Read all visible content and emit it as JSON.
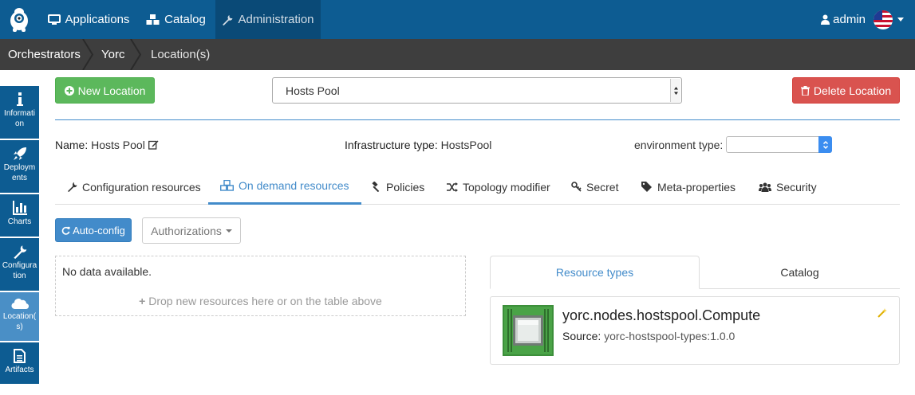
{
  "navbar": {
    "items": [
      {
        "label": "Applications",
        "icon": "monitor-icon"
      },
      {
        "label": "Catalog",
        "icon": "cubes-icon"
      },
      {
        "label": "Administration",
        "icon": "wrench-icon"
      }
    ],
    "user": "admin",
    "flag_icon": "us-flag-icon"
  },
  "breadcrumb": [
    "Orchestrators",
    "Yorc",
    "Location(s)"
  ],
  "sidebar": [
    {
      "label": "Information",
      "lines": [
        "Informati",
        "on"
      ],
      "icon": "info-icon"
    },
    {
      "label": "Deployments",
      "lines": [
        "Deploym",
        "ents"
      ],
      "icon": "rocket-icon"
    },
    {
      "label": "Charts",
      "lines": [
        "Charts"
      ],
      "icon": "bar-chart-icon"
    },
    {
      "label": "Configuration",
      "lines": [
        "Configura",
        "tion"
      ],
      "icon": "wrench-icon"
    },
    {
      "label": "Location(s)",
      "lines": [
        "Location(",
        "s)"
      ],
      "icon": "cloud-icon"
    },
    {
      "label": "Artifacts",
      "lines": [
        "Artifacts"
      ],
      "icon": "file-icon"
    }
  ],
  "toolbar": {
    "new_location": "New Location",
    "location_select": "Hosts Pool",
    "delete_location": "Delete Location"
  },
  "info": {
    "name_label": "Name:",
    "name_value": "Hosts Pool",
    "infra_label": "Infrastructure type:",
    "infra_value": "HostsPool",
    "env_label": "environment type:",
    "env_value": ""
  },
  "tabs": [
    {
      "label": "Configuration resources",
      "icon": "wrench-icon"
    },
    {
      "label": "On demand resources",
      "icon": "cubes-icon",
      "active": true
    },
    {
      "label": "Policies",
      "icon": "gavel-icon"
    },
    {
      "label": "Topology modifier",
      "icon": "random-icon"
    },
    {
      "label": "Secret",
      "icon": "key-icon"
    },
    {
      "label": "Meta-properties",
      "icon": "tags-icon"
    },
    {
      "label": "Security",
      "icon": "users-icon"
    }
  ],
  "actions": {
    "auto_config": "Auto-config",
    "authorizations": "Authorizations"
  },
  "resources": {
    "empty_text": "No data available.",
    "drop_hint": "Drop new resources here or on the table above"
  },
  "right_tabs": [
    "Resource types",
    "Catalog"
  ],
  "resource_type": {
    "name": "yorc.nodes.hostspool.Compute",
    "source_label": "Source:",
    "source_value": "yorc-hostspool-types:1.0.0"
  },
  "colors": {
    "navbar": "#0d5c92",
    "breadcrumb": "#3e3e3e",
    "accent": "#428bca",
    "success": "#5cb85c",
    "danger": "#d9534f"
  }
}
